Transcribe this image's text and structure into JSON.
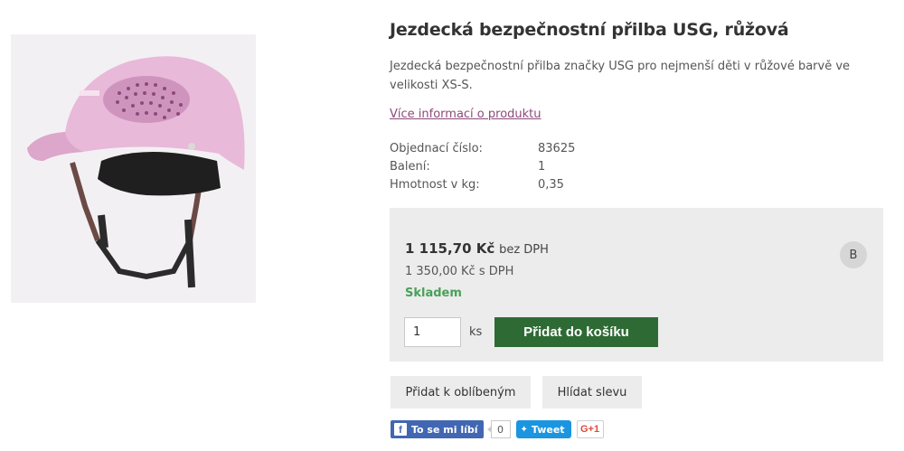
{
  "product": {
    "title": "Jezdecká bezpečnostní přilba USG, růžová",
    "description": "Jezdecká bezpečnostní přilba značky USG pro nejmenší děti v růžové barvě ve velikosti XS-S.",
    "more_info_link": "Více informací o produktu",
    "image_icon": "helmet-image"
  },
  "specs": [
    {
      "label": "Objednací číslo:",
      "value": "83625"
    },
    {
      "label": "Balení:",
      "value": "1"
    },
    {
      "label": "Hmotnost v kg:",
      "value": "0,35"
    }
  ],
  "pricing": {
    "price_amount": "1 115,70 Kč",
    "price_suffix": "bez DPH",
    "price_with_vat": "1 350,00 Kč s DPH",
    "stock_status": "Skladem",
    "badge": "B",
    "quantity": "1",
    "unit": "ks",
    "add_to_cart": "Přidat do košíku"
  },
  "actions": {
    "add_favorite": "Přidat k oblíbeným",
    "watch_discount": "Hlídat slevu"
  },
  "social": {
    "fb_like": "To se mi líbí",
    "fb_count": "0",
    "tweet": "Tweet",
    "gplus": "G+1"
  },
  "colors": {
    "accent_green": "#2e6b34",
    "stock_green": "#4aa05a",
    "link_purple": "#8c4a7a",
    "panel_grey": "#ececec",
    "helmet_pink": "#e8b9d8"
  }
}
